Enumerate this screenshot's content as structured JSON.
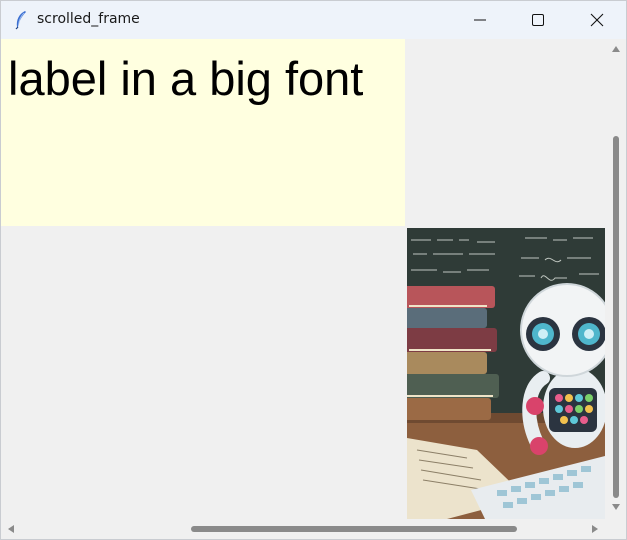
{
  "window": {
    "title": "scrolled_frame",
    "controls": {
      "minimize_icon": "minimize-icon",
      "maximize_icon": "maximize-icon",
      "close_icon": "close-icon"
    }
  },
  "content": {
    "big_label": "label in a big font",
    "big_label_background": "#ffffe0",
    "picture": {
      "subject": "robot-with-books-illustration"
    }
  },
  "scrollbars": {
    "vertical_position": 0.2,
    "horizontal_position": 0.31
  }
}
